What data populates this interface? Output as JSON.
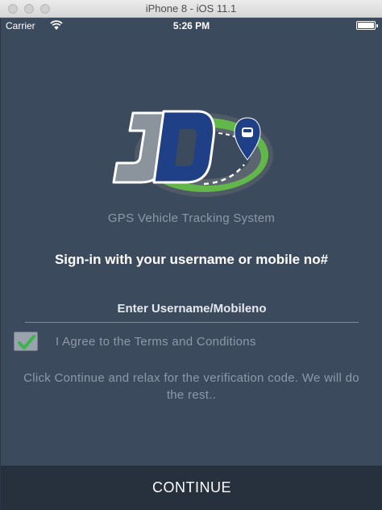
{
  "window": {
    "title": "iPhone 8 - iOS 11.1"
  },
  "status_bar": {
    "carrier": "Carrier",
    "time": "5:26 PM"
  },
  "logo": {
    "text": "JD"
  },
  "subtitle": "GPS Vehicle Tracking System",
  "headline": "Sign-in with your username or mobile no#",
  "username_field": {
    "placeholder": "Enter Username/Mobileno",
    "value": ""
  },
  "terms": {
    "label": "I Agree to the Terms and Conditions",
    "checked": true
  },
  "info_text": "Click Continue and relax for the verification code. We will do the rest..",
  "continue_button": {
    "label": "CONTINUE"
  },
  "colors": {
    "background": "#3c4a5e",
    "button_bg": "#26313d",
    "muted_text": "#8d99a8",
    "check_green": "#39b54a",
    "logo_blue": "#1f3f86",
    "logo_green": "#62b64a"
  }
}
